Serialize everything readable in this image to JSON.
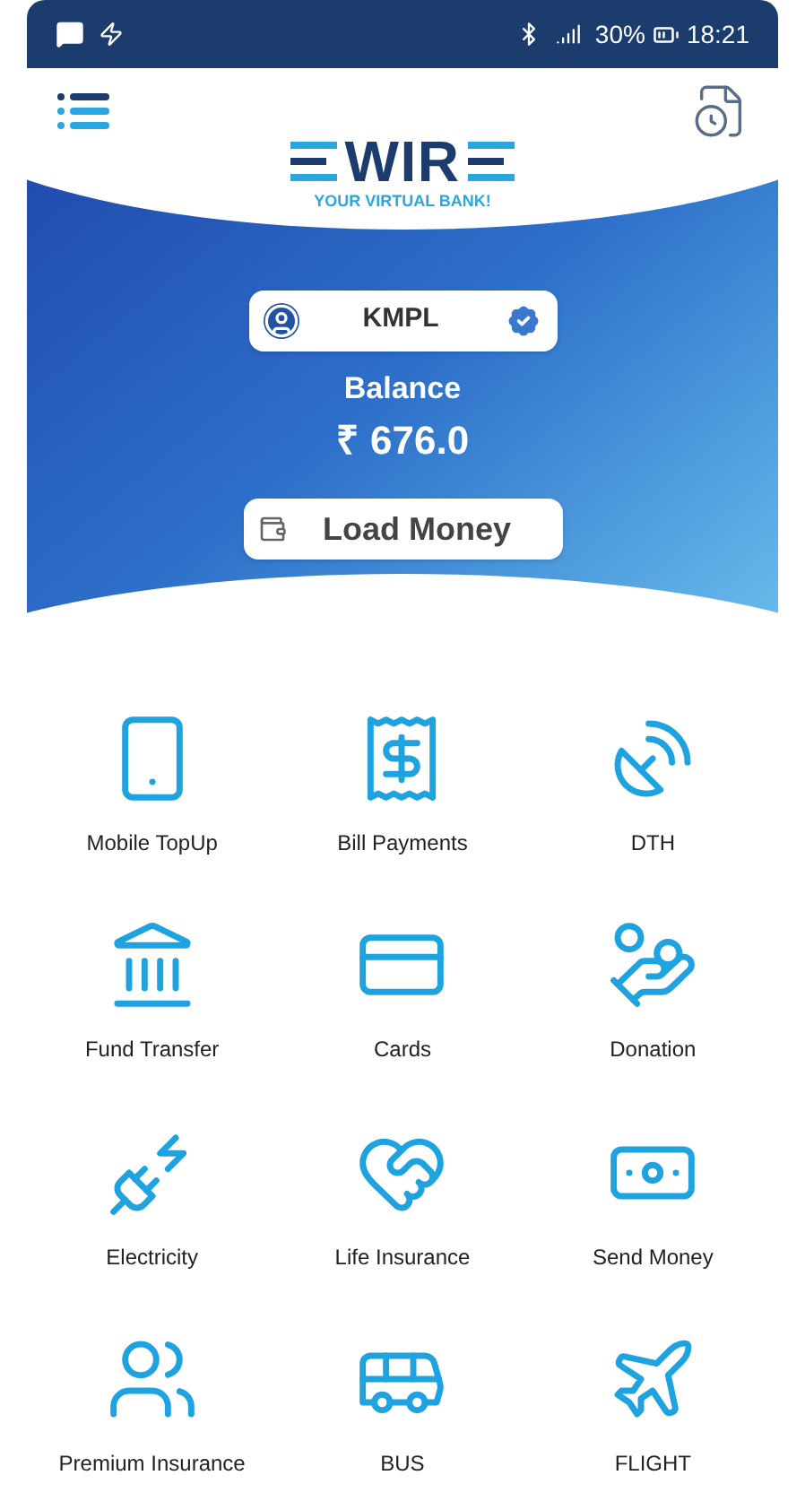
{
  "status_bar": {
    "battery": "30%",
    "time": "18:21"
  },
  "logo": {
    "wordmark": "WIR",
    "tagline": "YOUR VIRTUAL BANK!"
  },
  "account": {
    "name": "KMPL",
    "verified": true
  },
  "balance": {
    "label": "Balance",
    "amount": "₹ 676.0"
  },
  "load_money": {
    "label": "Load Money"
  },
  "services": [
    {
      "label": "Mobile TopUp"
    },
    {
      "label": "Bill Payments"
    },
    {
      "label": "DTH"
    },
    {
      "label": "Fund Transfer"
    },
    {
      "label": "Cards"
    },
    {
      "label": "Donation"
    },
    {
      "label": "Electricity"
    },
    {
      "label": "Life Insurance"
    },
    {
      "label": "Send Money"
    },
    {
      "label": "Premium Insurance"
    },
    {
      "label": "BUS"
    },
    {
      "label": "FLIGHT"
    }
  ]
}
